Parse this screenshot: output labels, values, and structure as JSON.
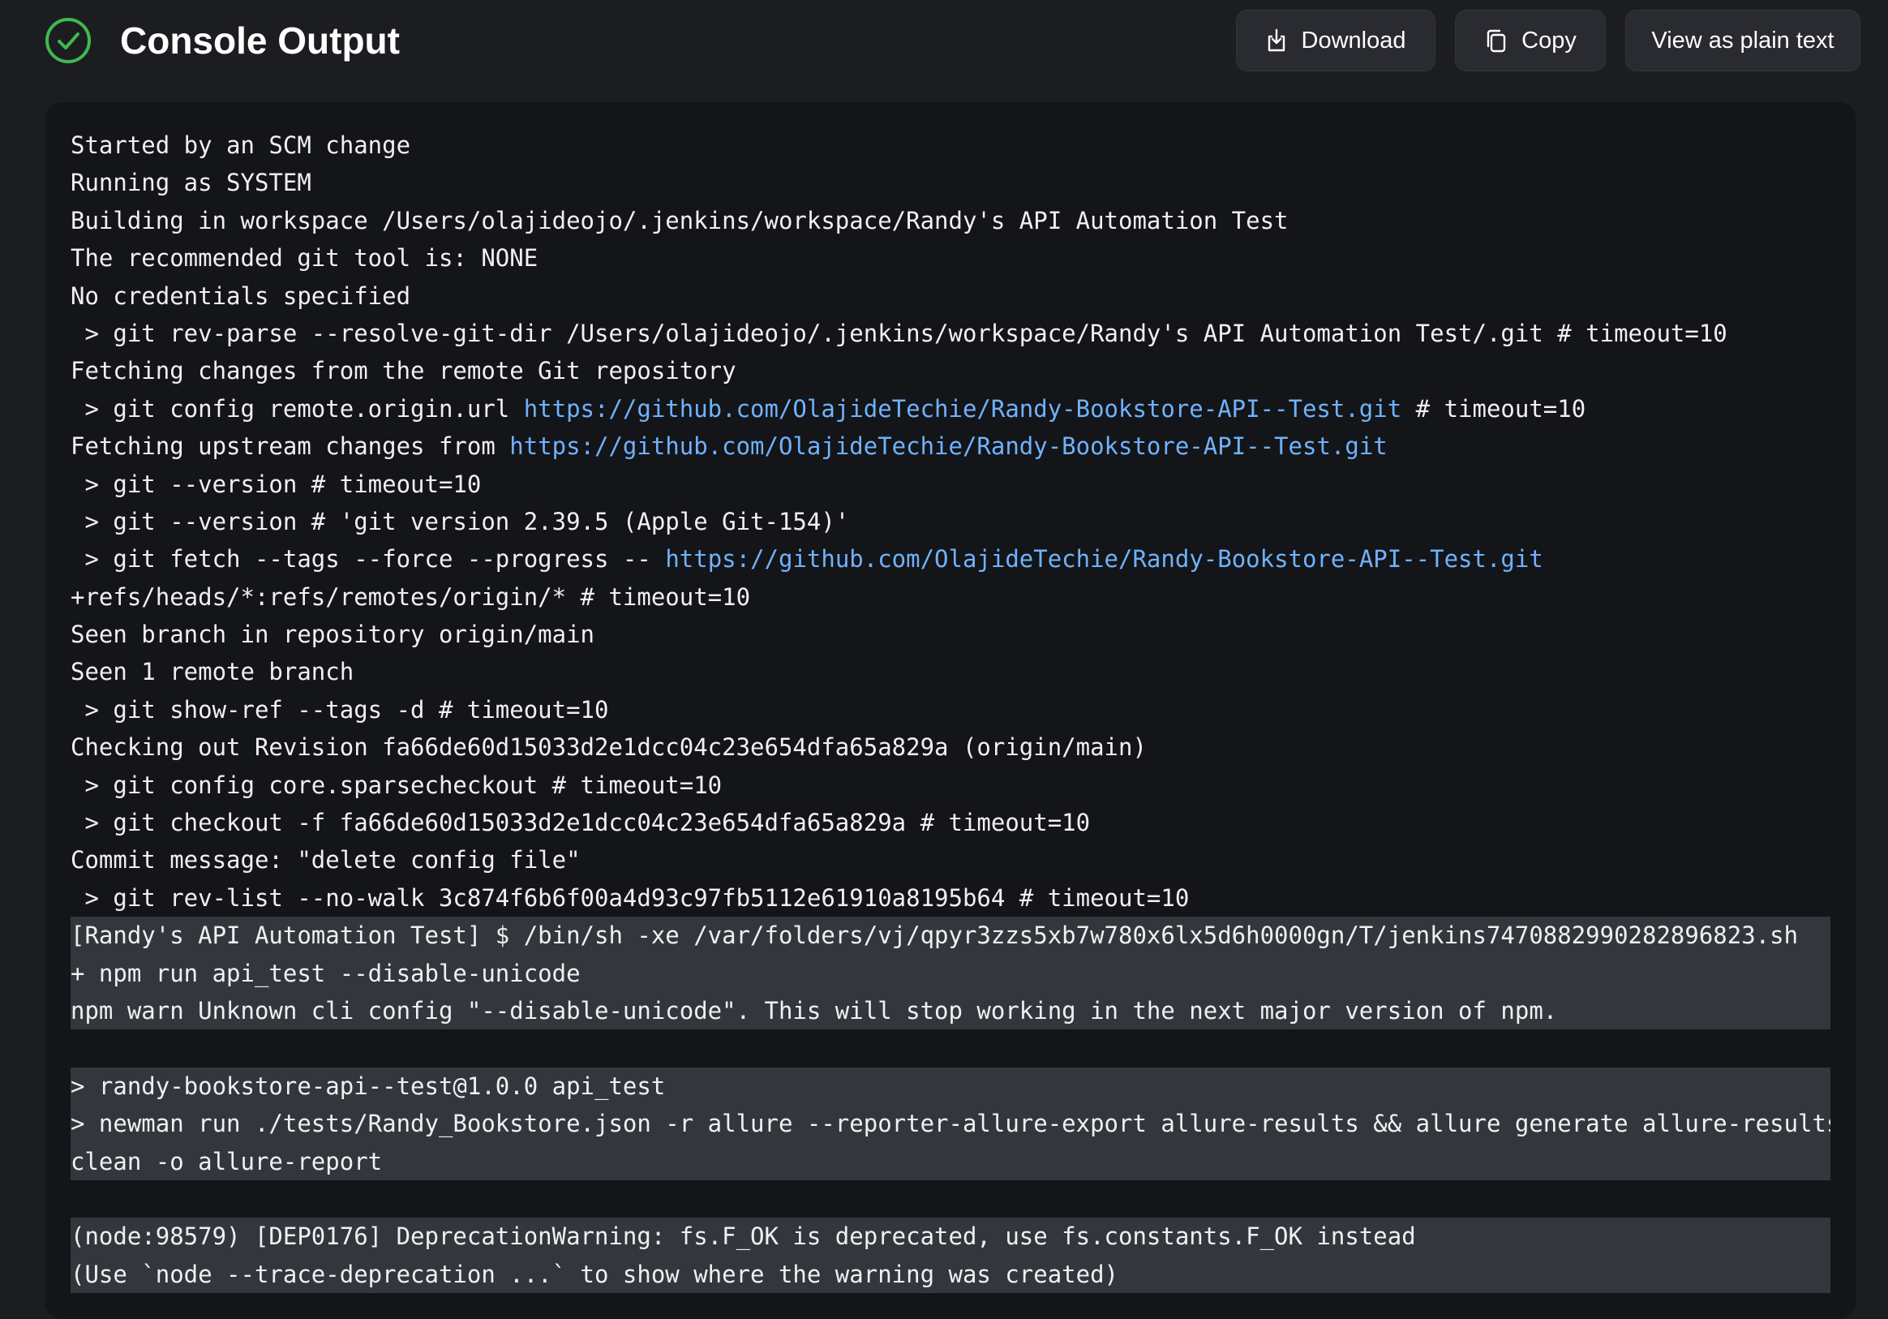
{
  "header": {
    "title": "Console Output",
    "status_color": "#3fb950",
    "status_icon": "check-circle-icon",
    "buttons": {
      "download": "Download",
      "copy": "Copy",
      "plain_text": "View as plain text"
    }
  },
  "console": {
    "link_color": "#6fb2ff",
    "highlight_color": "#33373d",
    "lines": [
      {
        "text": "Started by an SCM change",
        "hl": false
      },
      {
        "text": "Running as SYSTEM",
        "hl": false
      },
      {
        "text": "Building in workspace /Users/olajideojo/.jenkins/workspace/Randy's API Automation Test",
        "hl": false
      },
      {
        "text": "The recommended git tool is: NONE",
        "hl": false
      },
      {
        "text": "No credentials specified",
        "hl": false
      },
      {
        "text": " > git rev-parse --resolve-git-dir /Users/olajideojo/.jenkins/workspace/Randy's API Automation Test/.git # timeout=10",
        "hl": false
      },
      {
        "text": "Fetching changes from the remote Git repository",
        "hl": false
      },
      {
        "text": " > git config remote.origin.url ",
        "link": "https://github.com/OlajideTechie/Randy-Bookstore-API--Test.git",
        "after": " # timeout=10",
        "hl": false
      },
      {
        "text": "Fetching upstream changes from ",
        "link": "https://github.com/OlajideTechie/Randy-Bookstore-API--Test.git",
        "after": "",
        "hl": false
      },
      {
        "text": " > git --version # timeout=10",
        "hl": false
      },
      {
        "text": " > git --version # 'git version 2.39.5 (Apple Git-154)'",
        "hl": false
      },
      {
        "text": " > git fetch --tags --force --progress -- ",
        "link": "https://github.com/OlajideTechie/Randy-Bookstore-API--Test.git",
        "after": "",
        "hl": false
      },
      {
        "text": "+refs/heads/*:refs/remotes/origin/* # timeout=10",
        "hl": false
      },
      {
        "text": "Seen branch in repository origin/main",
        "hl": false
      },
      {
        "text": "Seen 1 remote branch",
        "hl": false
      },
      {
        "text": " > git show-ref --tags -d # timeout=10",
        "hl": false
      },
      {
        "text": "Checking out Revision fa66de60d15033d2e1dcc04c23e654dfa65a829a (origin/main)",
        "hl": false
      },
      {
        "text": " > git config core.sparsecheckout # timeout=10",
        "hl": false
      },
      {
        "text": " > git checkout -f fa66de60d15033d2e1dcc04c23e654dfa65a829a # timeout=10",
        "hl": false
      },
      {
        "text": "Commit message: \"delete config file\"",
        "hl": false
      },
      {
        "text": " > git rev-list --no-walk 3c874f6b6f00a4d93c97fb5112e61910a8195b64 # timeout=10",
        "hl": false
      },
      {
        "text": "[Randy's API Automation Test] $ /bin/sh -xe /var/folders/vj/qpyr3zzs5xb7w780x6lx5d6h0000gn/T/jenkins7470882990282896823.sh",
        "hl": true
      },
      {
        "text": "+ npm run api_test --disable-unicode",
        "hl": true
      },
      {
        "text": "npm warn Unknown cli config \"--disable-unicode\". This will stop working in the next major version of npm.",
        "hl": true
      },
      {
        "text": "",
        "hl": false
      },
      {
        "text": "> randy-bookstore-api--test@1.0.0 api_test",
        "hl": true
      },
      {
        "text": "> newman run ./tests/Randy_Bookstore.json -r allure --reporter-allure-export allure-results && allure generate allure-results --",
        "hl": true
      },
      {
        "text": "clean -o allure-report",
        "hl": true
      },
      {
        "text": "",
        "hl": false
      },
      {
        "text": "(node:98579) [DEP0176] DeprecationWarning: fs.F_OK is deprecated, use fs.constants.F_OK instead",
        "hl": true
      },
      {
        "text": "(Use `node --trace-deprecation ...` to show where the warning was created)",
        "hl": true
      }
    ]
  }
}
